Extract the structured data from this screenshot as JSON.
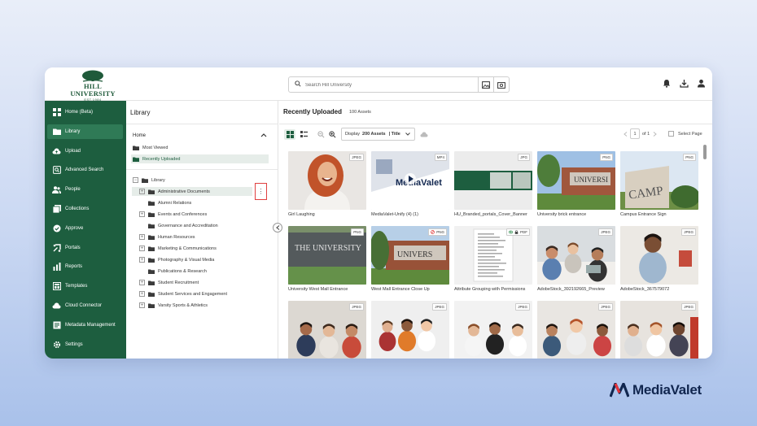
{
  "brand": {
    "name": "HILL UNIVERSITY",
    "established": "EST.1984",
    "accent": "#1d5e3f"
  },
  "search": {
    "placeholder": "Search Hill University"
  },
  "sidebar": {
    "items": [
      {
        "label": "Home (Beta)",
        "icon": "grid-icon"
      },
      {
        "label": "Library",
        "icon": "folder-icon",
        "active": true
      },
      {
        "label": "Upload",
        "icon": "cloud-upload-icon"
      },
      {
        "label": "Advanced Search",
        "icon": "advanced-search-icon"
      },
      {
        "label": "People",
        "icon": "people-icon"
      },
      {
        "label": "Collections",
        "icon": "collections-icon"
      },
      {
        "label": "Approve",
        "icon": "approve-icon"
      },
      {
        "label": "Portals",
        "icon": "portals-icon"
      },
      {
        "label": "Reports",
        "icon": "reports-icon"
      },
      {
        "label": "Templates",
        "icon": "templates-icon"
      },
      {
        "label": "Cloud Connector",
        "icon": "cloud-icon"
      },
      {
        "label": "Metadata Management",
        "icon": "metadata-icon"
      },
      {
        "label": "Settings",
        "icon": "gear-icon"
      }
    ]
  },
  "library": {
    "title": "Library",
    "home_label": "Home",
    "quick": [
      {
        "label": "Most Viewed"
      },
      {
        "label": "Recently Uploaded"
      }
    ],
    "tree_root": "Library",
    "tree": [
      {
        "label": "Administrative Documents",
        "expandable": true,
        "selected": true
      },
      {
        "label": "Alumni Relations",
        "expandable": false
      },
      {
        "label": "Events and Conferences",
        "expandable": true
      },
      {
        "label": "Governance and Accreditation",
        "expandable": false
      },
      {
        "label": "Human Resources",
        "expandable": true
      },
      {
        "label": "Marketing & Communications",
        "expandable": true
      },
      {
        "label": "Photography & Visual Media",
        "expandable": true
      },
      {
        "label": "Publications & Research",
        "expandable": false
      },
      {
        "label": "Student Recruitment",
        "expandable": true
      },
      {
        "label": "Student Services and Engagement",
        "expandable": true
      },
      {
        "label": "Varsity Sports & Athletics",
        "expandable": true
      }
    ],
    "more_menu": "⋮"
  },
  "main": {
    "title": "Recently Uploaded",
    "asset_count": "100 Assets",
    "display": {
      "prefix": "Display",
      "count": "200 Assets",
      "sort": "| Title"
    },
    "pager": {
      "page": "1",
      "of": "of 1"
    },
    "select_page": "Select Page",
    "assets": [
      {
        "name": "Girl Laughing",
        "type": "JPEG",
        "scene": "portrait"
      },
      {
        "name": "MediaValet-Unify (4) (1)",
        "type": "MP4",
        "scene": "video"
      },
      {
        "name": "HU_Branded_portals_Cover_Banner",
        "type": "JPG",
        "scene": "banner"
      },
      {
        "name": "University brick entrance",
        "type": "PNG",
        "scene": "brick"
      },
      {
        "name": "Campus Entrance Sign",
        "type": "PNG",
        "scene": "sign"
      },
      {
        "name": "University West Mall Entrance",
        "type": "PNG",
        "scene": "stone"
      },
      {
        "name": "West Mall Entrance Close Up",
        "type": "PNG",
        "scene": "brick2",
        "blocked": true
      },
      {
        "name": "Attribute Grouping with Permissions",
        "type": "PDF",
        "scene": "doc",
        "locked": true
      },
      {
        "name": "AdobeStock_392192665_Preview",
        "type": "JPEG",
        "scene": "class"
      },
      {
        "name": "AdobeStock_367579072",
        "type": "JPEG",
        "scene": "student"
      },
      {
        "name": "",
        "type": "JPEG",
        "scene": "group1"
      },
      {
        "name": "",
        "type": "JPEG",
        "scene": "group2"
      },
      {
        "name": "",
        "type": "JPEG",
        "scene": "group3"
      },
      {
        "name": "",
        "type": "JPEG",
        "scene": "group4"
      },
      {
        "name": "",
        "type": "JPEG",
        "scene": "group5"
      }
    ]
  },
  "watermark": {
    "name": "MediaValet"
  }
}
